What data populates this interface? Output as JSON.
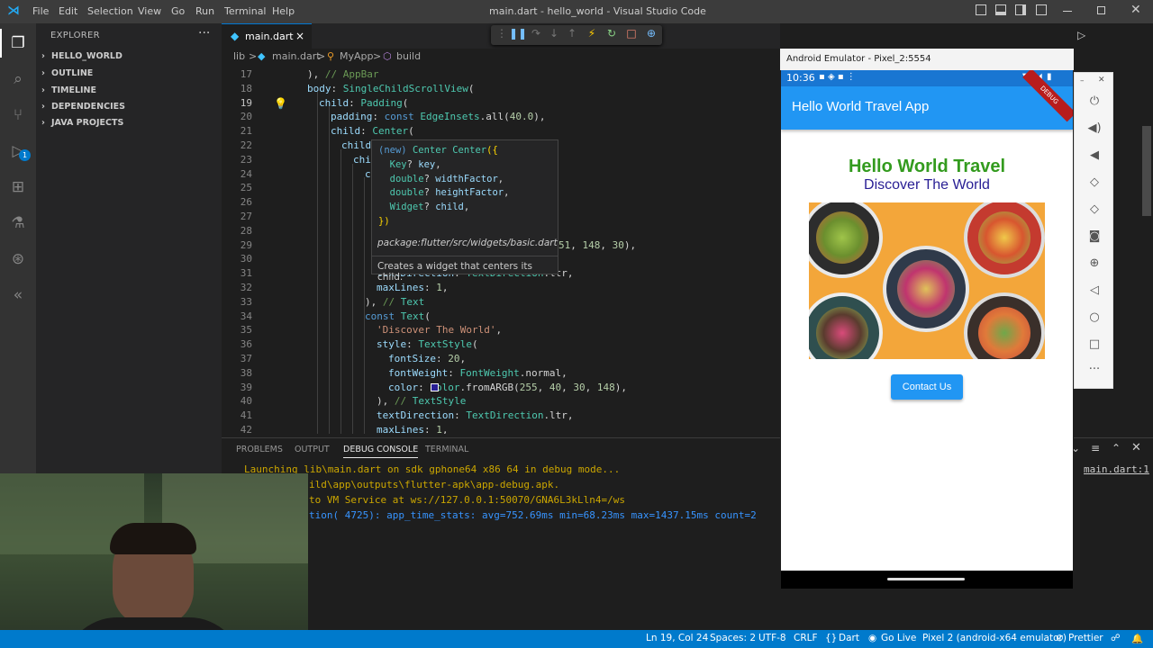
{
  "window": {
    "title": "main.dart - hello_world - Visual Studio Code",
    "menu": [
      "File",
      "Edit",
      "Selection",
      "View",
      "Go",
      "Run",
      "Terminal",
      "Help"
    ]
  },
  "sidebar": {
    "header": "EXPLORER",
    "more": "···",
    "sections": [
      "HELLO_WORLD",
      "OUTLINE",
      "TIMELINE",
      "DEPENDENCIES",
      "JAVA PROJECTS"
    ]
  },
  "activity_badge": "1",
  "tabs": [
    {
      "label": "main.dart",
      "close": "×"
    }
  ],
  "breadcrumb": [
    "lib",
    ">",
    "main.dart",
    ">",
    "MyApp",
    ">",
    "build"
  ],
  "editor": {
    "lines": [
      {
        "n": "17",
        "code": "), // AppBar"
      },
      {
        "n": "18",
        "code": "body: SingleChildScrollView("
      },
      {
        "n": "19",
        "code": "child: Padding("
      },
      {
        "n": "20",
        "code": "padding: const EdgeInsets.all(40.0),"
      },
      {
        "n": "21",
        "code": "child: Center("
      },
      {
        "n": "22",
        "code": "child"
      },
      {
        "n": "23",
        "code": "chi"
      },
      {
        "n": "24",
        "code": "c"
      },
      {
        "n": "25",
        "code": ""
      },
      {
        "n": "26",
        "code": ""
      },
      {
        "n": "27",
        "code": ""
      },
      {
        "n": "28",
        "code": ""
      },
      {
        "n": "29",
        "code": "51, 148, 30),"
      },
      {
        "n": "30",
        "code": ""
      },
      {
        "n": "31",
        "code": "textDirection: TextDirection.ltr,"
      },
      {
        "n": "32",
        "code": "maxLines: 1,"
      },
      {
        "n": "33",
        "code": "), // Text"
      },
      {
        "n": "34",
        "code": "const Text("
      },
      {
        "n": "35",
        "code": "'Discover The World',"
      },
      {
        "n": "36",
        "code": "style: TextStyle("
      },
      {
        "n": "37",
        "code": "fontSize: 20,"
      },
      {
        "n": "38",
        "code": "fontWeight: FontWeight.normal,"
      },
      {
        "n": "39",
        "code": "color: Color.fromARGB(255, 40, 30, 148),"
      },
      {
        "n": "40",
        "code": "), // TextStyle"
      },
      {
        "n": "41",
        "code": "textDirection: TextDirection.ltr,"
      },
      {
        "n": "42",
        "code": "maxLines: 1,"
      }
    ]
  },
  "hover": {
    "lines": [
      "(new) Center Center({",
      "  Key? key,",
      "  double? widthFactor,",
      "  double? heightFactor,",
      "  Widget? child,",
      "})"
    ],
    "package": "package:flutter/src/widgets/basic.dart",
    "description": "Creates a widget that centers its child."
  },
  "panel": {
    "tabs": [
      "PROBLEMS",
      "OUTPUT",
      "DEBUG CONSOLE",
      "TERMINAL"
    ],
    "active_tab": "DEBUG CONSOLE",
    "console": [
      "Launching lib\\main.dart on sdk gphone64 x86 64 in debug mode...",
      "ild\\app\\outputs\\flutter-apk\\app-debug.apk.",
      "to VM Service at ws://127.0.0.1:50070/GNA6L3kLln4=/ws",
      "tion( 4725): app_time_stats: avg=752.69ms min=68.23ms max=1437.15ms count=2"
    ],
    "source_link": "main.dart:1"
  },
  "statusbar": {
    "position": "Ln 19, Col 24",
    "spaces": "Spaces: 2",
    "encoding": "UTF-8",
    "eol": "CRLF",
    "language": "Dart",
    "golive": "Go Live",
    "device": "Pixel 2 (android-x64 emulator)",
    "prettier": "Prettier"
  },
  "emulator": {
    "title": "Android Emulator - Pixel_2:5554",
    "time": "10:36",
    "debug_banner": "DEBUG",
    "app_title": "Hello World Travel App",
    "heading": "Hello World Travel",
    "subheading": "Discover The World",
    "button": "Contact Us",
    "heading_color": "#339b1e",
    "subheading_color": "#281e94",
    "appbar_color": "#2196f3"
  },
  "icons": {
    "files": "files-icon",
    "search": "search-icon",
    "scm": "source-control-icon",
    "debug": "run-debug-icon",
    "extensions": "extensions-icon",
    "testing": "flask-icon",
    "git": "git-graph-icon",
    "flutter": "flutter-icon"
  },
  "colors": {
    "statusbar": "#007acc",
    "activity": "#333333",
    "sidebar": "#252526",
    "editor": "#1e1e1e"
  }
}
